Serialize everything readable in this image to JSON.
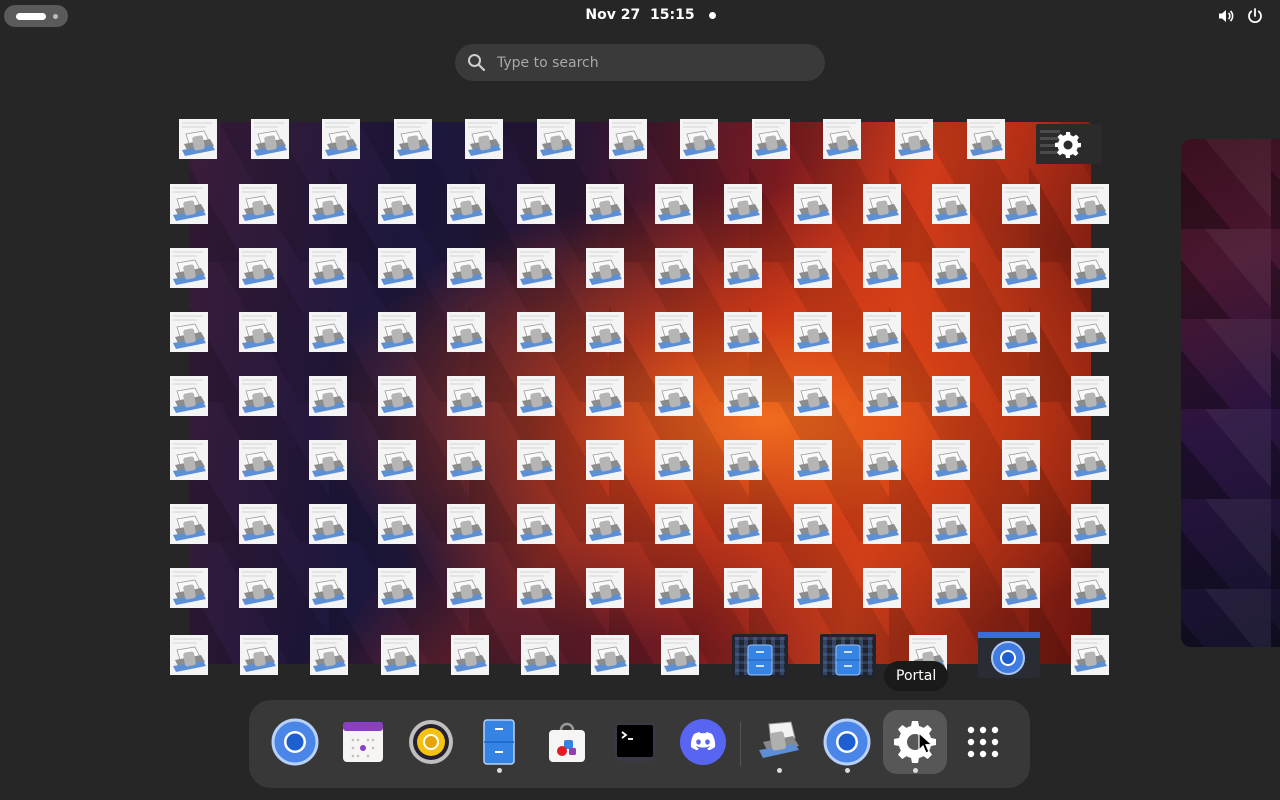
{
  "topbar": {
    "date": "Nov 27",
    "time": "15:15"
  },
  "search": {
    "placeholder": "Type to search"
  },
  "tooltip": {
    "label": "Portal"
  },
  "dash": {
    "items": [
      {
        "name": "chromium",
        "icon": "chromium-icon",
        "running": false
      },
      {
        "name": "calendar",
        "icon": "calendar-icon",
        "running": false
      },
      {
        "name": "rhythmbox",
        "icon": "speaker-icon",
        "running": false
      },
      {
        "name": "files",
        "icon": "file-cabinet-icon",
        "running": true
      },
      {
        "name": "software",
        "icon": "store-bag-icon",
        "running": false
      },
      {
        "name": "terminal",
        "icon": "terminal-icon",
        "running": false
      },
      {
        "name": "discord",
        "icon": "discord-icon",
        "running": false
      },
      {
        "name": "printer-app",
        "icon": "printer-icon",
        "running": true
      },
      {
        "name": "chromium-running",
        "icon": "chromium-icon",
        "running": true
      },
      {
        "name": "portal",
        "icon": "gear-icon",
        "running": true
      },
      {
        "name": "show-apps",
        "icon": "app-grid-icon",
        "running": false
      }
    ]
  },
  "colors": {
    "panel": "#262626",
    "dash": "#383838",
    "search": "#3a3a3a",
    "accent": "#3584e4"
  }
}
